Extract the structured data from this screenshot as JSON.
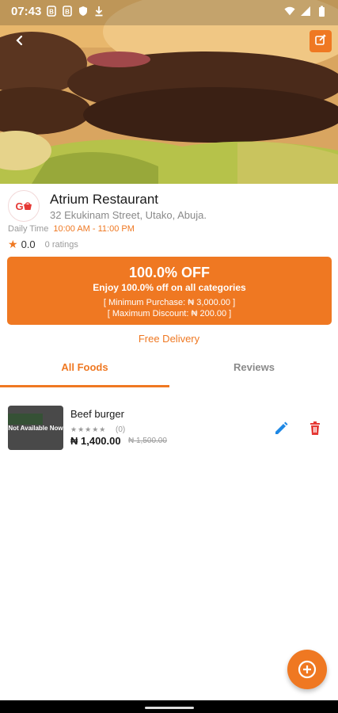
{
  "status_bar": {
    "time": "07:43"
  },
  "header": {
    "back_icon": "arrow-back-icon",
    "edit_icon": "edit-square-icon"
  },
  "restaurant": {
    "logo_text": "G",
    "name": "Atrium Restaurant",
    "address": "32 Ekukinam Street, Utako, Abuja.",
    "daily_time_label": "Daily Time",
    "hours": "10:00 AM - 11:00 PM",
    "rating": "0.0",
    "ratings_count": "0 ratings"
  },
  "offer": {
    "title": "100.0% OFF",
    "subtitle": "Enjoy 100.0% off on all categories",
    "min_purchase": "[ Minimum Purchase: ₦ 3,000.00 ]",
    "max_discount": "[ Maximum Discount: ₦ 200.00 ]"
  },
  "free_delivery": "Free Delivery",
  "tabs": [
    {
      "label": "All Foods",
      "active": true
    },
    {
      "label": "Reviews",
      "active": false
    }
  ],
  "foods": [
    {
      "name": "Beef burger",
      "availability": "Not Available Now",
      "stars": "★★★★★",
      "review_count": "(0)",
      "price": "₦ 1,400.00",
      "old_price": "₦ 1,500.00"
    }
  ],
  "colors": {
    "accent": "#ef7822",
    "delete": "#e53935",
    "edit": "#1e88e5"
  }
}
